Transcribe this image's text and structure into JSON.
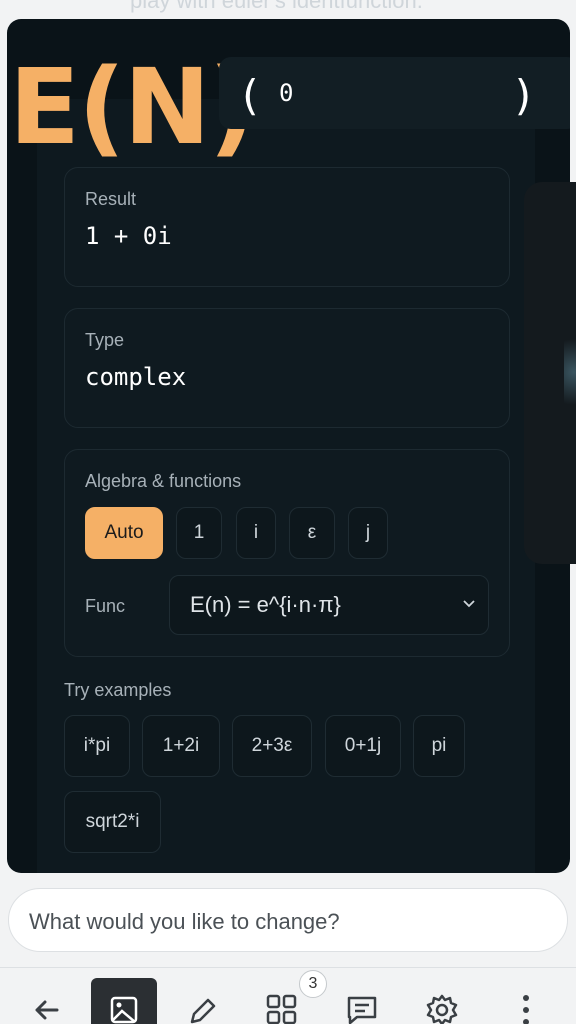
{
  "header": {
    "caption": "play with euler's identfunction.",
    "title": "E(N)",
    "input_open_paren": "(",
    "input_value": "0",
    "input_close_paren": ")"
  },
  "result": {
    "label": "Result",
    "value": "1 + 0i"
  },
  "type": {
    "label": "Type",
    "value": "complex"
  },
  "algebra": {
    "label": "Algebra & functions",
    "options": [
      "Auto",
      "1",
      "i",
      "ε",
      "j"
    ],
    "selected": "Auto",
    "func_label": "Func",
    "func_value": "E(n) = e^{i·n·π}"
  },
  "examples": {
    "label": "Try examples",
    "items": [
      "i*pi",
      "1+2i",
      "2+3ε",
      "0+1j",
      "pi",
      "sqrt2*i"
    ]
  },
  "prompt": {
    "placeholder": "What would you like to change?"
  },
  "bottom_nav": {
    "items": [
      "back-arrow-icon",
      "image-icon",
      "pencil-icon",
      "grid-icon",
      "chat-icon",
      "gear-icon",
      "more-icon"
    ],
    "badge_count": "3"
  },
  "colors": {
    "accent": "#f5b066",
    "card_bg": "#0a1318",
    "page_bg": "#f2f3f4"
  }
}
